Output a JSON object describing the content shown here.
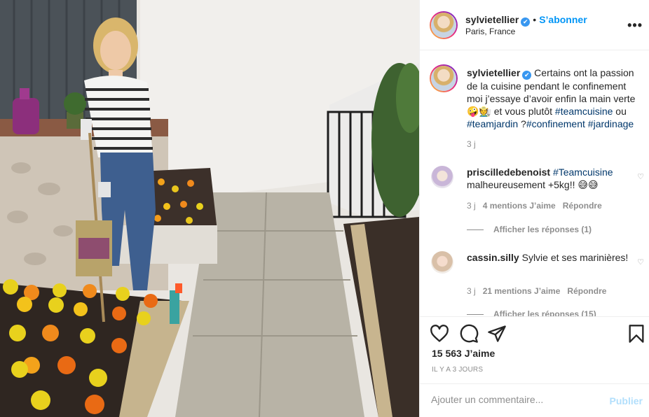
{
  "post": {
    "username": "sylvietellier",
    "verified_mark": "✔",
    "dot": "•",
    "follow_label": "S’abonner",
    "location": "Paris, France",
    "more_label": "•••"
  },
  "caption": {
    "username": "sylvietellier",
    "text": "Certains ont la passion de la cuisine pendant le confinement moi j’essaye d’avoir enfin la main verte 🤪🧑‍🌾 et vous plutôt ",
    "tag1": "#teamcuisine",
    "mid": " ou ",
    "tag2": "#teamjardin",
    "mid2": " ?",
    "tag3": "#confinement",
    "tag4": "#jardinage",
    "age": "3 j"
  },
  "comments": [
    {
      "username": "priscilledebenoist",
      "tag": "#Teamcuisine",
      "text": " malheureusement +5kg!! 😅😅",
      "age": "3 j",
      "likes": "4 mentions J’aime",
      "reply": "Répondre",
      "show_replies": "Afficher les réponses (1)"
    },
    {
      "username": "cassin.silly",
      "text": " Sylvie et ses marinières!",
      "age": "3 j",
      "likes": "21 mentions J’aime",
      "reply": "Répondre",
      "show_replies": "Afficher les réponses (15)"
    }
  ],
  "actions": {
    "likes_count": "15 563 J’aime",
    "timestamp": "IL Y A 3 JOURS",
    "like_icon": "heart-icon",
    "comment_icon": "comment-icon",
    "share_icon": "paper-plane-icon",
    "save_icon": "bookmark-icon"
  },
  "add_comment": {
    "placeholder": "Ajouter un commentaire...",
    "publish_label": "Publier"
  },
  "colors": {
    "accent": "#0095f6",
    "hashtag": "#00376b",
    "muted": "#8e8e8e",
    "publish_disabled": "#b2dffc"
  }
}
